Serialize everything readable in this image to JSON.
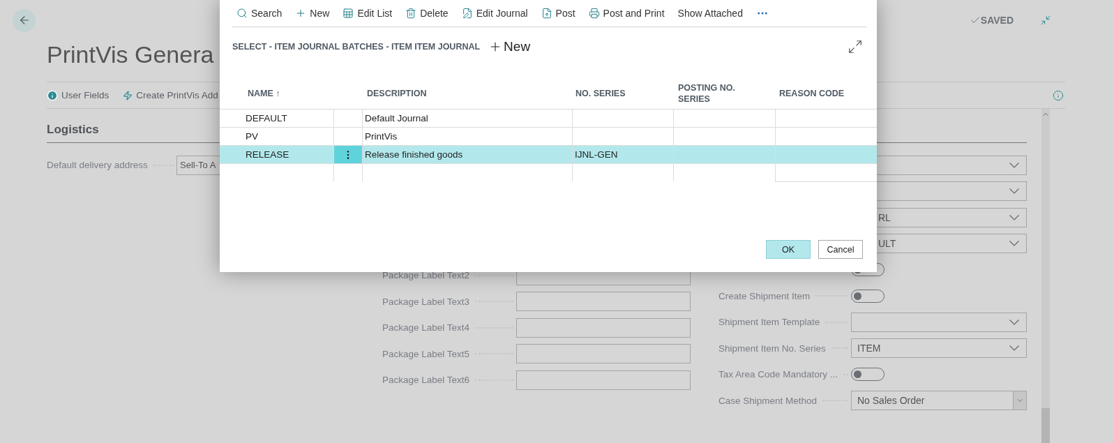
{
  "page": {
    "title": "PrintVis Genera",
    "status": "SAVED",
    "actions": [
      {
        "label": "User Fields",
        "kind": "info"
      },
      {
        "label": "Create PrintVis Add",
        "kind": "bolt"
      }
    ],
    "section": "Logistics",
    "fields_left": [
      {
        "label": "Default delivery address",
        "kind": "text",
        "value": "Sell-To A"
      }
    ],
    "fields_middle": [
      {
        "label": "Package Label Text2",
        "kind": "text"
      },
      {
        "label": "Package Label Text3",
        "kind": "text"
      },
      {
        "label": "Package Label Text4",
        "kind": "text"
      },
      {
        "label": "Package Label Text5",
        "kind": "text"
      },
      {
        "label": "Package Label Text6",
        "kind": "text"
      }
    ],
    "fields_right": [
      {
        "kind": "dropdown"
      },
      {
        "kind": "dropdown"
      },
      {
        "kind": "dropdown",
        "value": "RL"
      },
      {
        "kind": "dropdown",
        "value": "ULT"
      },
      {
        "kind": "toggle",
        "on": false
      },
      {
        "kind": "toggle",
        "label": "Create Shipment Item",
        "on": false
      },
      {
        "kind": "dropdown",
        "label": "Shipment Item Template"
      },
      {
        "kind": "dropdown",
        "label": "Shipment Item No. Series",
        "value": "ITEM"
      },
      {
        "kind": "toggle",
        "label": "Tax Area Code Mandatory ...",
        "on": false
      },
      {
        "kind": "select",
        "label": "Case Shipment Method",
        "value": "No Sales Order"
      }
    ]
  },
  "dialog": {
    "actions": [
      {
        "label": "Search",
        "kind": "search"
      },
      {
        "label": "New",
        "kind": "new"
      },
      {
        "label": "Edit List",
        "kind": "edit-list"
      },
      {
        "label": "Delete",
        "kind": "delete"
      },
      {
        "label": "Edit Journal",
        "kind": "edit-journal"
      },
      {
        "label": "Post",
        "kind": "post"
      },
      {
        "label": "Post and Print",
        "kind": "print"
      },
      {
        "label": "Show Attached",
        "kind": "plain"
      }
    ],
    "title": "SELECT - ITEM JOURNAL BATCHES - ITEM ITEM JOURNAL",
    "new_label": "New",
    "columns": [
      {
        "label": "NAME ↑"
      },
      {
        "label": "DESCRIPTION"
      },
      {
        "label": "NO. SERIES"
      },
      {
        "label": "POSTING NO. SERIES"
      },
      {
        "label": "REASON CODE"
      }
    ],
    "rows": [
      {
        "name": "DEFAULT",
        "description": "Default Journal",
        "selected": false
      },
      {
        "name": "PV",
        "description": "PrintVis",
        "selected": false
      },
      {
        "name": "RELEASE",
        "description": "Release finished goods",
        "no_series": "IJNL-GEN",
        "selected": true
      }
    ],
    "buttons": [
      {
        "label": "OK",
        "kind": "primary"
      },
      {
        "label": "Cancel",
        "kind": "secondary"
      }
    ]
  }
}
